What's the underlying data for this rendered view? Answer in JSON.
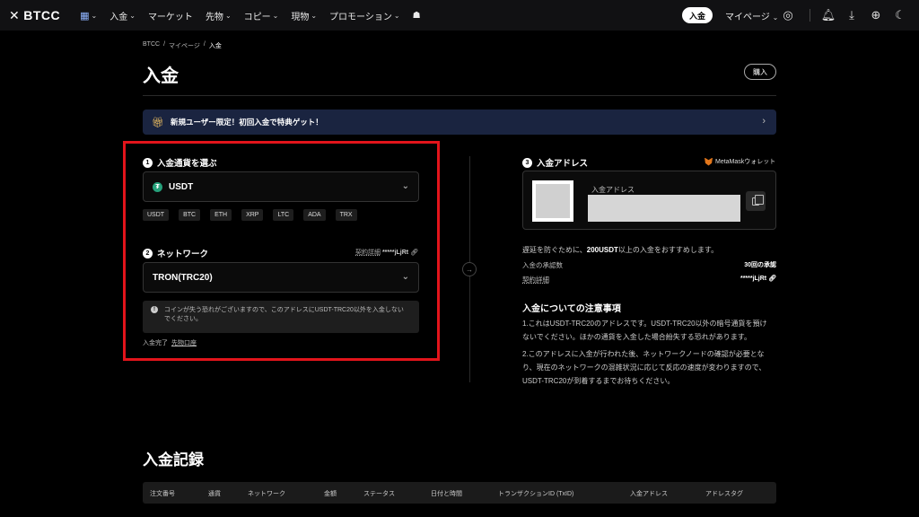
{
  "nav": {
    "logo": "BTCC",
    "items": [
      {
        "label": "入金",
        "chevron": true
      },
      {
        "label": "マーケット",
        "chevron": false
      },
      {
        "label": "先物",
        "chevron": true
      },
      {
        "label": "コピー",
        "chevron": true
      },
      {
        "label": "現物",
        "chevron": true
      },
      {
        "label": "プロモーション",
        "chevron": true
      }
    ],
    "deposit_button": "入金",
    "mypage": "マイページ"
  },
  "breadcrumb": [
    "BTCC",
    "マイページ",
    "入金"
  ],
  "page_title": "入金",
  "buy_button": "購入",
  "banner": "新規ユーザー限定！初回入金で特典ゲット！",
  "step1": {
    "num": "1",
    "title": "入金通貨を選ぶ",
    "selected": "USDT",
    "coins": [
      "USDT",
      "BTC",
      "ETH",
      "XRP",
      "LTC",
      "ADA",
      "TRX"
    ]
  },
  "step2": {
    "num": "2",
    "title": "ネットワーク",
    "contract_label": "契約詳細",
    "contract_value": "*****jLjRt",
    "selected": "TRON(TRC20)",
    "notice_line1": "コインが失う恐れがございますので、このアドレスにUSDT-TRC20以外を入金しない",
    "notice_line2": "でください。",
    "done_label": "入金完了",
    "done_link": "先物口座"
  },
  "step3": {
    "num": "3",
    "title": "入金アドレス",
    "metamask": "MetaMaskウォレット",
    "address_label": "入金アドレス"
  },
  "recommend": {
    "prefix": "遅延を防ぐために、",
    "amount": "200USDT",
    "suffix": "以上の入金をおすすめします。"
  },
  "details": {
    "confirm_label": "入金の承認数",
    "confirm_value": "30回の承認",
    "contract_label": "契約詳細",
    "contract_value": "*****jLjRt"
  },
  "caution": {
    "title": "入金についての注意事項",
    "p1a": "1.これはUSDT-TRC20のアドレスです。USDT-TRC20以外の暗号通貨を預け",
    "p1b": "ないでください。ほかの通貨を入金した場合紛失する恐れがあります。",
    "p2a": "2.このアドレスに入金が行われた後、ネットワークノードの確認が必要とな",
    "p2b": "り、現在のネットワークの混雑状況に応じて反応の速度が変わりますので、",
    "p2c": "USDT-TRC20が到着するまでお待ちください。"
  },
  "records": {
    "title": "入金記録",
    "columns": [
      "注文番号",
      "通貨",
      "ネットワーク",
      "金額",
      "ステータス",
      "日付と時間",
      "トランザクションID (TxID)",
      "入金アドレス",
      "アドレスタグ"
    ]
  },
  "colors": {
    "highlight": "#e2141b",
    "banner": "#1a2440",
    "tether": "#26a17b"
  }
}
